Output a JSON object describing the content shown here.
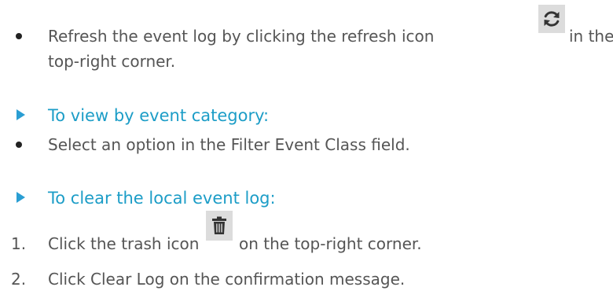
{
  "section_refresh": {
    "text_before_icon": "Refresh the event log by clicking the refresh icon",
    "text_after_icon": "in the",
    "text_line2": "top-right corner."
  },
  "section_category": {
    "heading": "To view by event category:",
    "step": "Select an option in the Filter Event Class field."
  },
  "section_clear": {
    "heading": "To clear the local event log:",
    "steps": [
      {
        "number": "1.",
        "text_before_icon": "Click the trash icon",
        "text_after_icon": "on the top-right corner."
      },
      {
        "number": "2.",
        "text": "Click Clear Log on the confirmation message."
      }
    ]
  },
  "icons": {
    "refresh": "refresh-icon",
    "trash": "trash-icon",
    "bullet": "bullet-dot",
    "heading_marker": "triangle-right-icon"
  },
  "colors": {
    "heading": "#1c9dc7",
    "marker": "#2a9ed3",
    "body_text": "#555555",
    "icon_background": "#dcdcdc"
  }
}
